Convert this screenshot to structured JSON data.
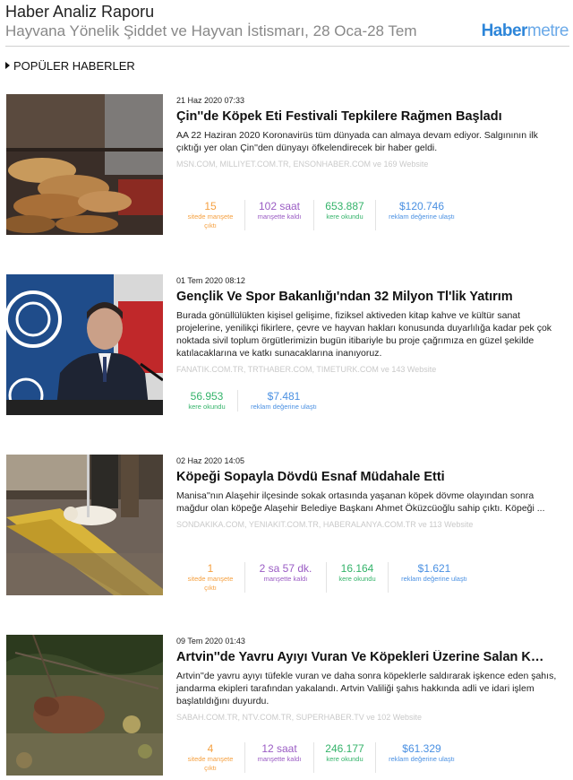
{
  "header": {
    "title": "Haber Analiz Raporu",
    "subtitle": "Hayvana Yönelik Şiddet ve Hayvan İstismarı, 28 Oca-28 Tem",
    "brand_part1": "Haber",
    "brand_part2": "metre"
  },
  "section_title": "POPÜLER HABERLER",
  "articles": [
    {
      "date": "21 Haz 2020 07:33",
      "title": "Çin''de Köpek Eti Festivali Tepkilere Rağmen Başladı",
      "summary": "AA 22 Haziran 2020 Koronavirüs tüm dünyada can almaya devam ediyor. Salgınının ilk çıktığı yer olan Çin''den dünyayı öfkelendirecek bir haber geldi.",
      "sources": "MSN.COM, MILLIYET.COM.TR, ENSONHABER.COM ve 169 Website",
      "stats": [
        {
          "value": "15",
          "label": "sitede manşete çıktı",
          "color": "orange"
        },
        {
          "value": "102 saat",
          "label": "manşette kaldı",
          "color": "purple"
        },
        {
          "value": "653.887",
          "label": "kere okundu",
          "color": "green"
        },
        {
          "value": "$120.746",
          "label": "reklam değerine ulaştı",
          "color": "blue"
        }
      ]
    },
    {
      "date": "01 Tem 2020 08:12",
      "title": "Gençlik Ve Spor Bakanlığı'ndan 32 Milyon Tl'lik Yatırım",
      "summary": "Burada gönüllülükten kişisel gelişime, fiziksel aktiveden kitap kahve ve kültür sanat projelerine, yenilikçi fikirlere, çevre ve hayvan hakları konusunda duyarlılığa kadar pek çok noktada sivil toplum örgütlerimizin bugün itibariyle bu proje çağrımıza en güzel şekilde katılacaklarına ve katkı sunacaklarına inanıyoruz.",
      "sources": "FANATIK.COM.TR, TRTHABER.COM, TIMETURK.COM ve 143 Website",
      "stats": [
        {
          "value": "56.953",
          "label": "kere okundu",
          "color": "green"
        },
        {
          "value": "$7.481",
          "label": "reklam değerine ulaştı",
          "color": "blue"
        }
      ]
    },
    {
      "date": "02 Haz 2020 14:05",
      "title": "Köpeği Sopayla Dövdü Esnaf Müdahale Etti",
      "summary": "Manisa''nın Alaşehir ilçesinde sokak ortasında yaşanan köpek dövme olayından sonra mağdur olan köpeğe Alaşehir Belediye Başkanı Ahmet Öküzcüoğlu sahip çıktı. Köpeği ...",
      "sources": "SONDAKIKA.COM, YENIAKIT.COM.TR, HABERALANYA.COM.TR ve 113 Website",
      "stats": [
        {
          "value": "1",
          "label": "sitede manşete çıktı",
          "color": "orange"
        },
        {
          "value": "2 sa 57 dk.",
          "label": "manşette kaldı",
          "color": "purple"
        },
        {
          "value": "16.164",
          "label": "kere okundu",
          "color": "green"
        },
        {
          "value": "$1.621",
          "label": "reklam değerine ulaştı",
          "color": "blue"
        }
      ]
    },
    {
      "date": "09 Tem 2020 01:43",
      "title": "Artvin''de Yavru Ayıyı Vuran Ve Köpekleri Üzerine Salan K…",
      "summary": "Artvin''de yavru ayıyı tüfekle vuran ve daha sonra köpeklerle saldırarak işkence eden şahıs, jandarma ekipleri tarafından yakalandı. Artvin Valiliği şahıs hakkında adli ve idari işlem başlatıldığını duyurdu.",
      "sources": "SABAH.COM.TR, NTV.COM.TR, SUPERHABER.TV ve 102 Website",
      "stats": [
        {
          "value": "4",
          "label": "sitede manşete çıktı",
          "color": "orange"
        },
        {
          "value": "12 saat",
          "label": "manşette kaldı",
          "color": "purple"
        },
        {
          "value": "246.177",
          "label": "kere okundu",
          "color": "green"
        },
        {
          "value": "$61.329",
          "label": "reklam değerine ulaştı",
          "color": "blue"
        }
      ]
    }
  ]
}
